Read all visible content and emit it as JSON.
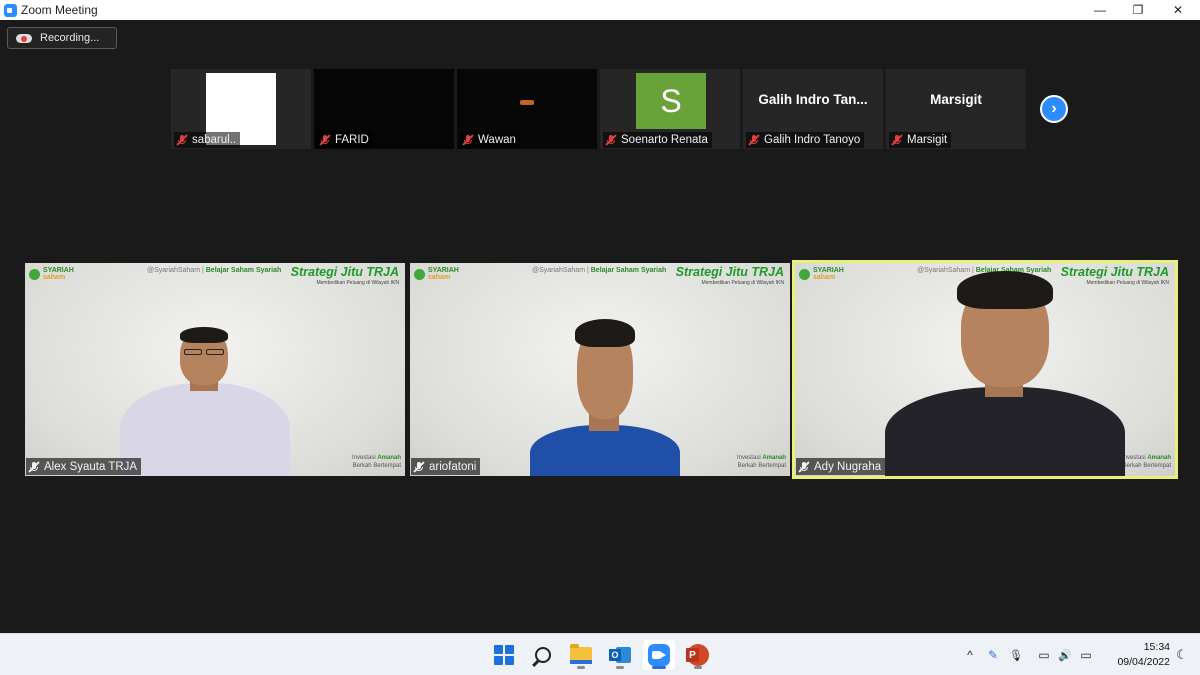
{
  "window": {
    "title": "Zoom Meeting",
    "controls": {
      "minimize": "—",
      "maximize": "❐",
      "close": "✕"
    }
  },
  "recording": {
    "label": "Recording..."
  },
  "thumbnails": [
    {
      "name": "sabarul..",
      "video": "white"
    },
    {
      "name": "FARID",
      "video": "black"
    },
    {
      "name": "Wawan",
      "video": "dark"
    },
    {
      "name": "Soenarto Renata",
      "video": "avatar",
      "avatar_letter": "S",
      "avatar_color": "#6aa23a"
    },
    {
      "name": "Galih Indro Tanoyo",
      "video": "name",
      "display_name": "Galih Indro Tan..."
    },
    {
      "name": "Marsigit",
      "video": "name",
      "display_name": "Marsigit"
    }
  ],
  "next_page_icon": "chevron-right-icon",
  "speakers": [
    {
      "name": "Alex Syauta TRJA",
      "active": false
    },
    {
      "name": "ariofatoni",
      "active": false
    },
    {
      "name": "Ady Nugraha",
      "active": true
    }
  ],
  "background": {
    "logo_line1": "SYARIAH",
    "logo_line2": "saham",
    "tagline_handle": "@SyariahSaham |",
    "tagline_bold": "Belajar Saham Syariah",
    "strategy_title": "Strategi Jitu TRJA",
    "strategy_sub": "Membedikan Peluang di Wilayah IKN",
    "footer_line1_a": "Investasi ",
    "footer_line1_b": "Amanah",
    "footer_line2_a": "Berkah ",
    "footer_line2_b": "Bertempat"
  },
  "taskbar": {
    "apps": [
      "start-icon",
      "search-icon",
      "file-explorer-icon",
      "outlook-icon",
      "zoom-icon",
      "powerpoint-icon"
    ],
    "outlook_letter": "O",
    "ppt_letter": "P",
    "tray": {
      "chevron": "^",
      "pen": "✎",
      "mic": "🎙",
      "network": "▭",
      "volume": "🔊",
      "battery": "▭",
      "moon": "☾"
    },
    "time": "15:34",
    "date": "09/04/2022"
  },
  "colors": {
    "accent": "#2d8cff",
    "active_speaker_border": "#e9f07a",
    "brand_green": "#1f9a2a",
    "mute_red": "#e04040"
  }
}
